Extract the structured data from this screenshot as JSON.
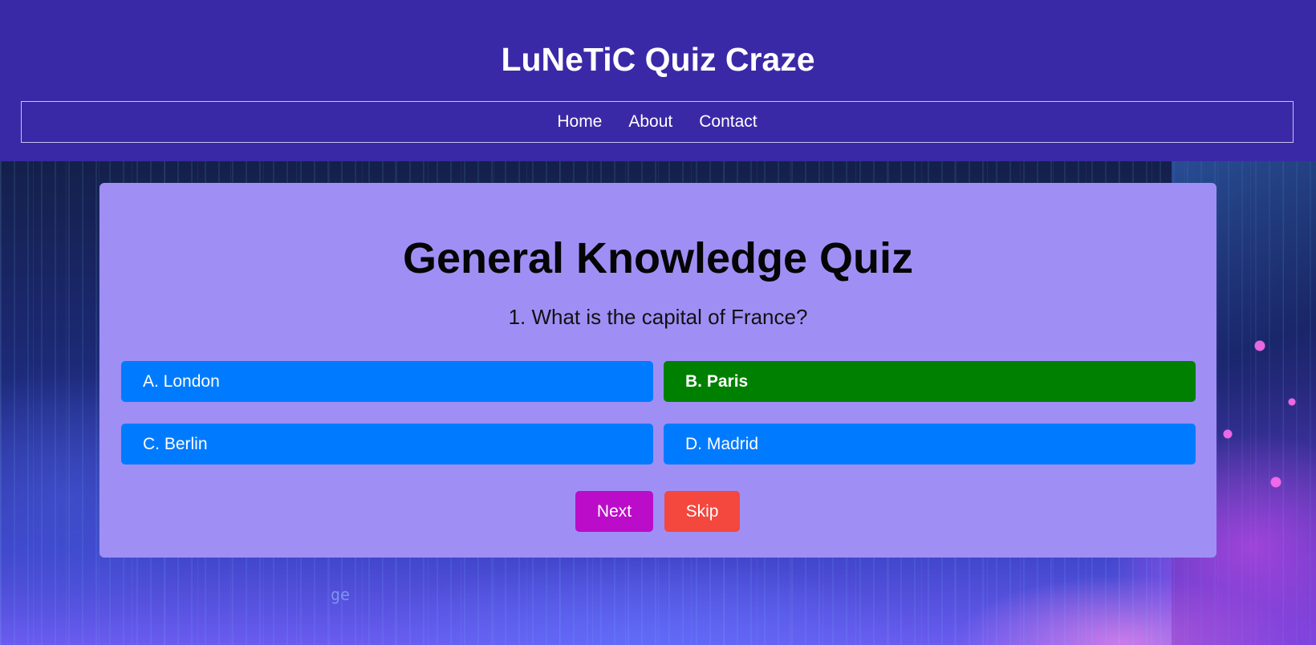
{
  "header": {
    "title": "LuNeTiC Quiz Craze",
    "background_color": "#3a29a6"
  },
  "nav": {
    "links": [
      {
        "label": "Home"
      },
      {
        "label": "About"
      },
      {
        "label": "Contact"
      }
    ]
  },
  "background": {
    "glyphs": "ge"
  },
  "quiz": {
    "title": "General Knowledge Quiz",
    "question": "1. What is the capital of France?",
    "options": [
      {
        "label": "A. London",
        "selected": false
      },
      {
        "label": "B. Paris",
        "selected": true
      },
      {
        "label": "C. Berlin",
        "selected": false
      },
      {
        "label": "D. Madrid",
        "selected": false
      }
    ],
    "next_label": "Next",
    "skip_label": "Skip",
    "colors": {
      "card": "#9f8ff5",
      "option": "#007bff",
      "option_selected": "#008000",
      "next": "#bb0cc9",
      "skip": "#f4473d"
    }
  }
}
